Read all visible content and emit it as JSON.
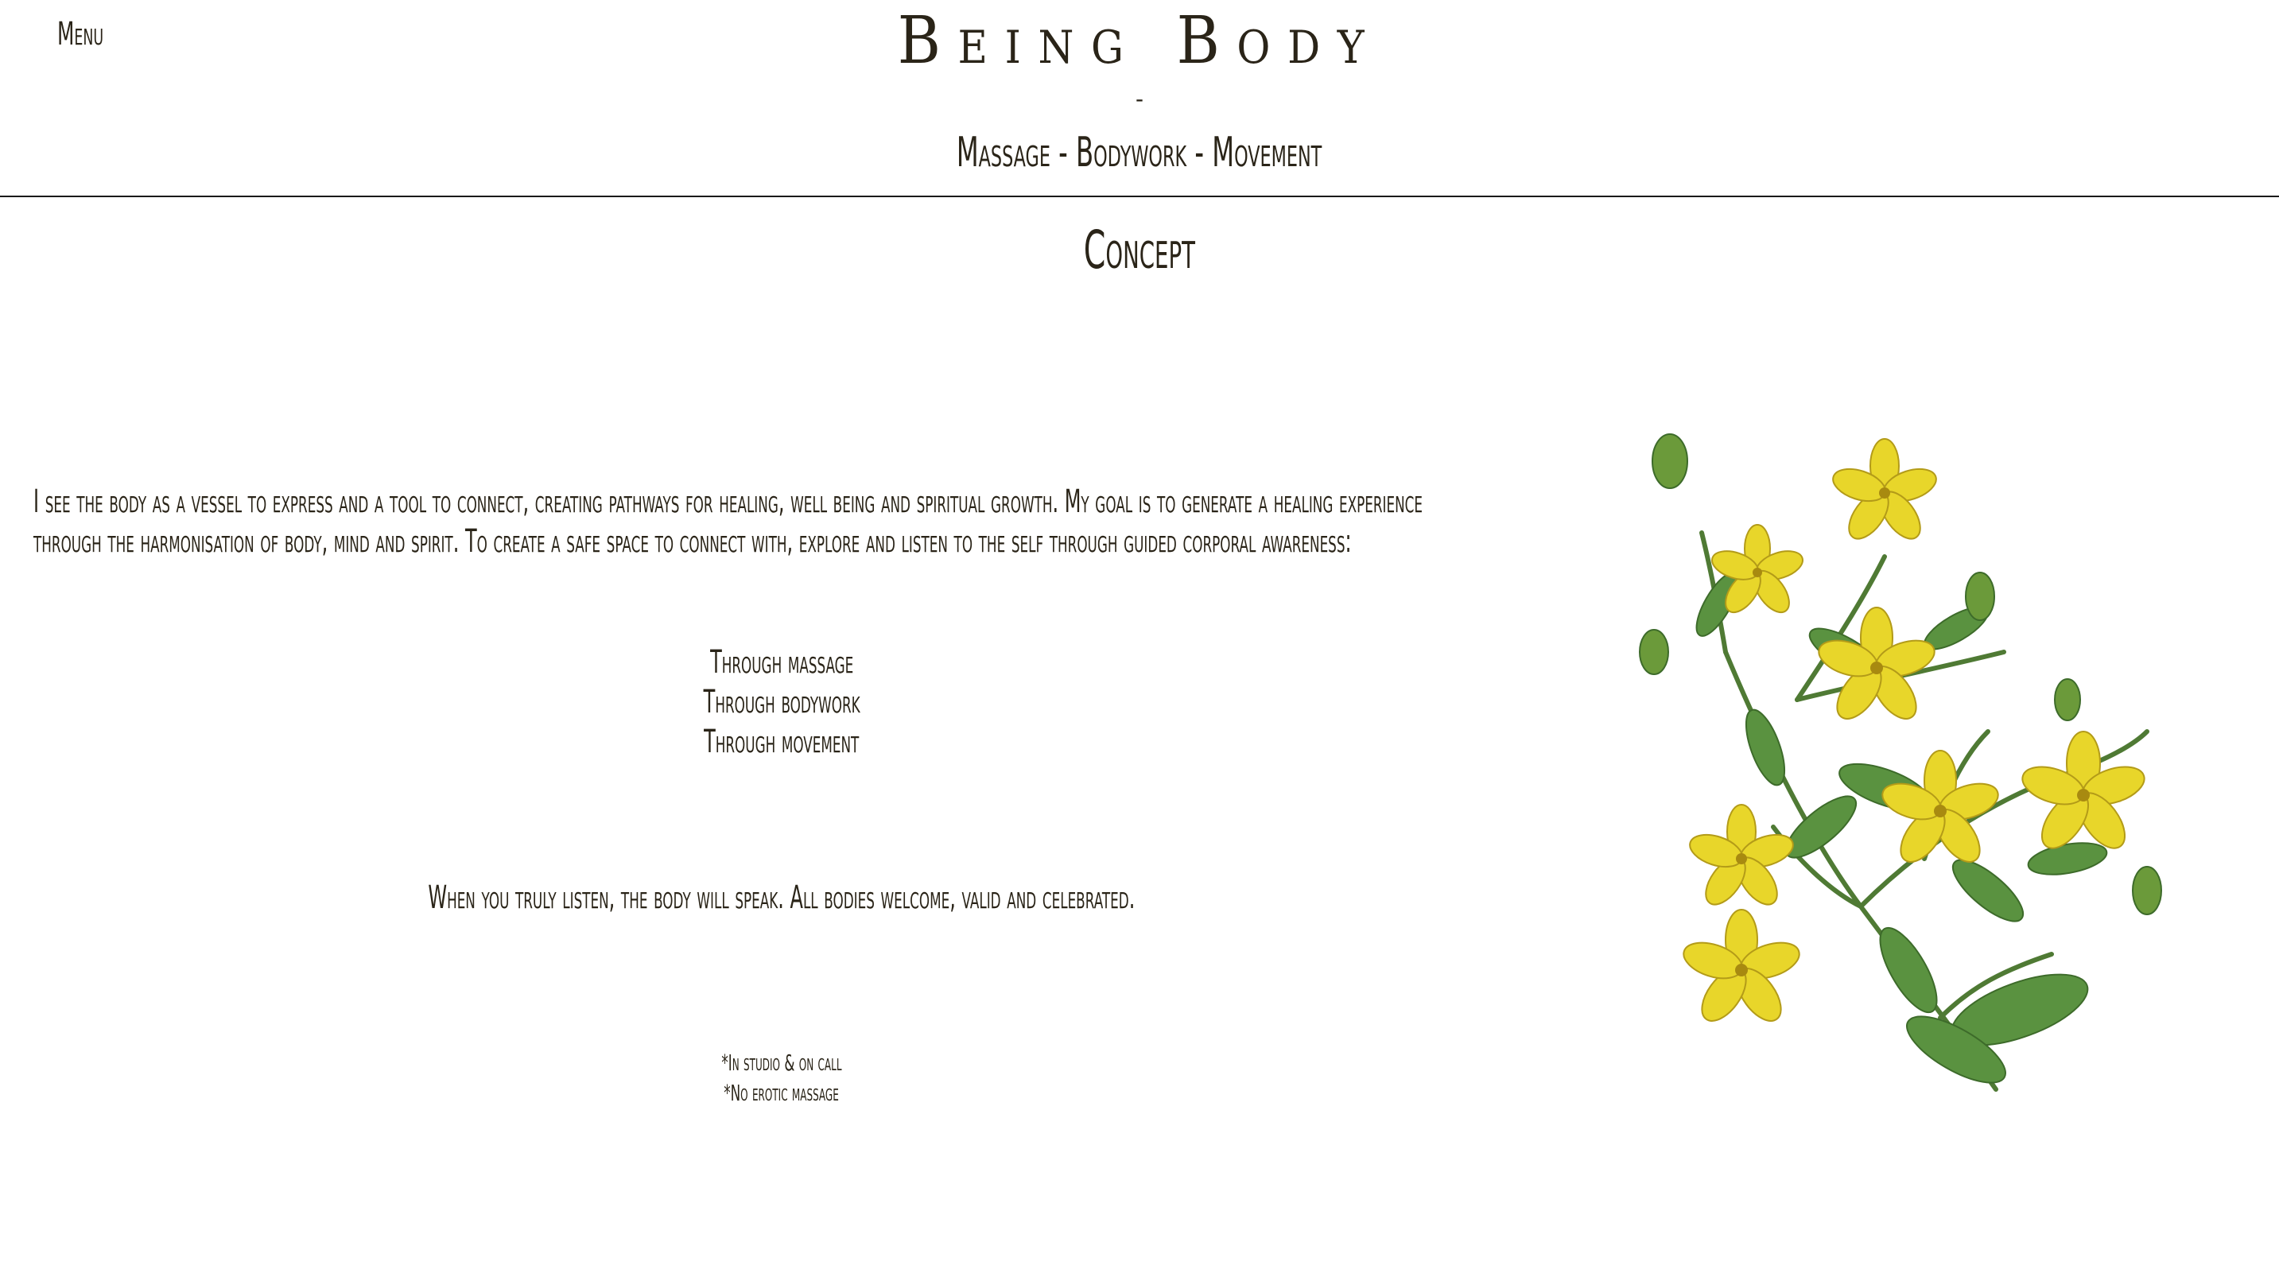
{
  "header": {
    "menu_label": "Menu",
    "brand": "Being Body",
    "dash": "-",
    "tagline": "Massage - Bodywork - Movement"
  },
  "main": {
    "title": "Concept",
    "intro_line1": "I see the body as a vessel to express and a tool to connect, creating pathways for healing, well being and spiritual growth. My goal is to generate a healing experience",
    "intro_line2": "through the harmonisation of body, mind and spirit. To create a safe space to connect with, explore and listen to the self through guided corporal awareness:",
    "through": [
      "Through massage",
      "Through bodywork",
      "Through movement"
    ],
    "quote": "When you truly listen, the body will speak. All bodies welcome, valid and celebrated.",
    "notes": [
      "*In studio & on call",
      "*No erotic massage"
    ]
  },
  "colors": {
    "text": "#2a2418",
    "petal": "#e8d62a",
    "leaf": "#4f8a3a"
  }
}
